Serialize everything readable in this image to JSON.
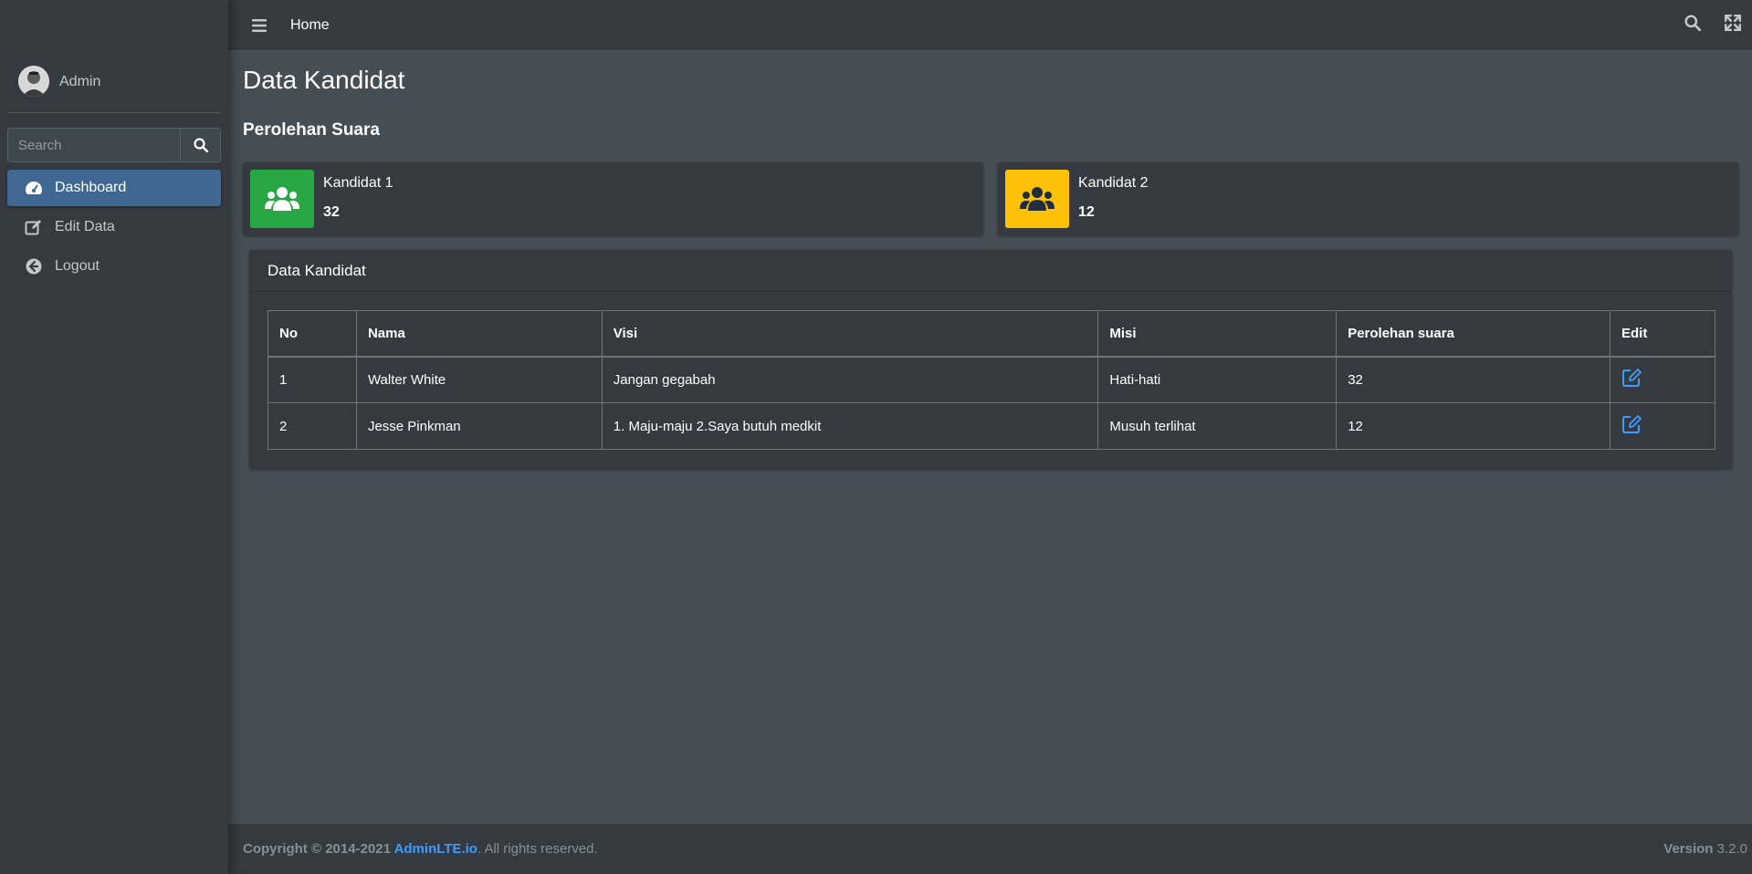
{
  "sidebar": {
    "user_name": "Admin",
    "search_placeholder": "Search",
    "items": [
      {
        "label": "Dashboard",
        "icon": "tachometer-icon",
        "active": true
      },
      {
        "label": "Edit Data",
        "icon": "edit-icon"
      },
      {
        "label": "Logout",
        "icon": "arrow-circle-left-icon"
      }
    ]
  },
  "navbar": {
    "home_label": "Home",
    "icons": [
      "bars-icon",
      "search-icon",
      "expand-icon"
    ]
  },
  "main": {
    "page_title": "Data Kandidat",
    "section_title": "Perolehan Suara",
    "info_boxes": [
      {
        "label": "Kandidat 1",
        "value": "32",
        "color": "#28a745",
        "icon": "users-icon"
      },
      {
        "label": "Kandidat 2",
        "value": "12",
        "color": "#ffc107",
        "icon": "users-icon"
      }
    ],
    "card_title": "Data Kandidat",
    "table": {
      "headers": [
        "No",
        "Nama",
        "Visi",
        "Misi",
        "Perolehan suara",
        "Edit"
      ],
      "rows": [
        {
          "no": "1",
          "nama": "Walter White",
          "visi": "Jangan gegabah",
          "misi": "Hati-hati",
          "suara": "32"
        },
        {
          "no": "2",
          "nama": "Jesse Pinkman",
          "visi": "1. Maju-maju 2.Saya butuh medkit",
          "misi": "Musuh terlihat",
          "suara": "12"
        }
      ]
    }
  },
  "footer": {
    "copyright_prefix": "Copyright © 2014-2021 ",
    "link_text": "AdminLTE.io",
    "suffix": ". All rights reserved.",
    "version_label": "Version",
    "version_number": " 3.2.0"
  },
  "colors": {
    "sidebar_bg": "#343a40",
    "content_bg": "#454d55",
    "active_item": "#3f6791",
    "link": "#3f9bff",
    "success": "#28a745",
    "warning": "#ffc107"
  }
}
